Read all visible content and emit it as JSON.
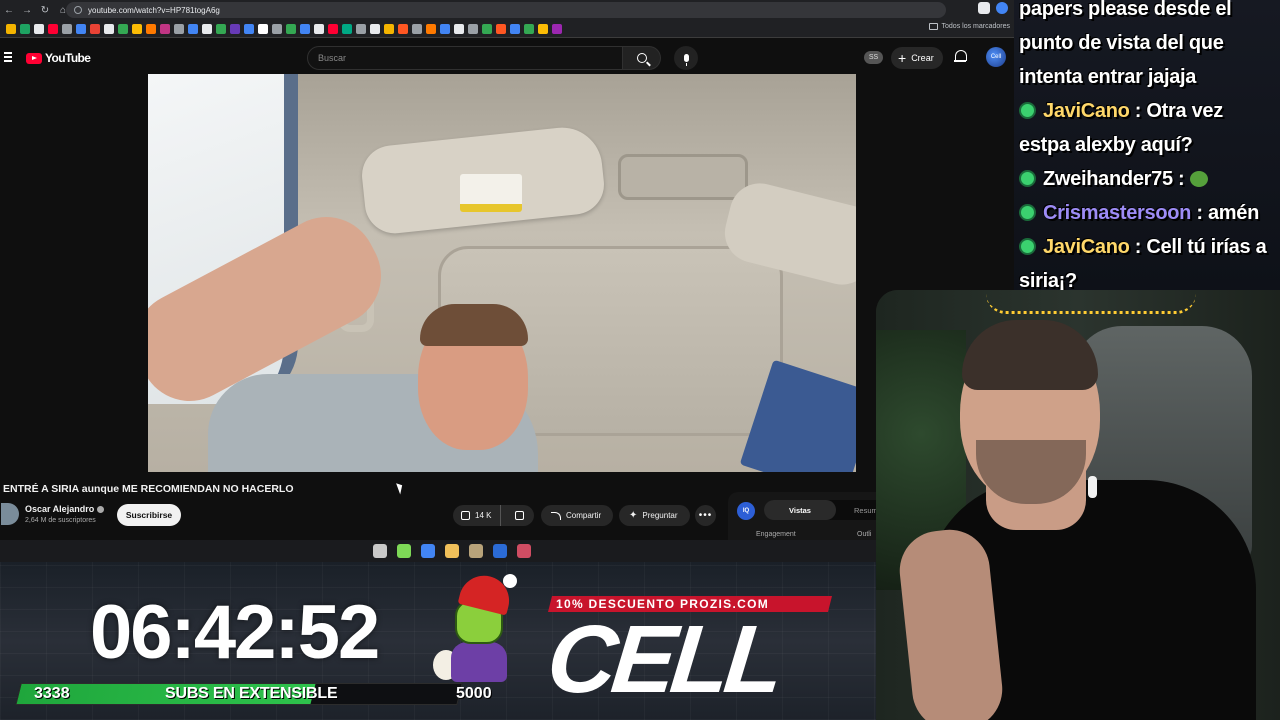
{
  "browser": {
    "url": "youtube.com/watch?v=HP781togA6g",
    "bookmarks_all_label": "Todos los marcadores",
    "bookmark_colors": [
      "#f4b400",
      "#1ea362",
      "#e8eaed",
      "#ff0033",
      "#9aa0a6",
      "#4285f4",
      "#ea4335",
      "#e8eaed",
      "#34a853",
      "#fbbc05",
      "#ff7a00",
      "#c13584",
      "#9aa0a6",
      "#4285f4",
      "#e8eaed",
      "#34a853",
      "#673ab7",
      "#4285f4",
      "#ffffff",
      "#9aa0a6",
      "#34a853",
      "#4285f4",
      "#e8eaed",
      "#ff0033",
      "#00a884",
      "#9aa0a6",
      "#e8eaed",
      "#f4b400",
      "#ff5722",
      "#9aa0a6",
      "#ff7a00",
      "#4285f4",
      "#e8eaed",
      "#9aa0a6",
      "#34a853",
      "#ff5722",
      "#4285f4",
      "#34a853",
      "#fbbc05",
      "#9c27b0"
    ]
  },
  "youtube": {
    "logo_text": "YouTube",
    "search_placeholder": "Buscar",
    "ss_badge": "SS",
    "create_label": "Crear",
    "avatar_text": "Cell"
  },
  "video": {
    "title": "ENTRÉ A SIRIA aunque ME RECOMIENDAN NO HACERLO",
    "channel_name": "Oscar Alejandro",
    "subscribers": "2,64 M de suscriptores",
    "subscribe_label": "Suscribirse",
    "likes": "14 K",
    "share_label": "Compartir",
    "ask_label": "Preguntar",
    "more_label": "•••"
  },
  "side_panel": {
    "icon_text": "IQ",
    "tab_active": "Vistas",
    "tab_other": "Resum",
    "engagement_label": "Engagement",
    "outlier_label": "Outli"
  },
  "taskbar": {
    "icon_colors": [
      "#c9c9c9",
      "#7ed957",
      "#4285f4",
      "#f0c05a",
      "#b8a37a",
      "#2b6bd6",
      "#d04d63"
    ],
    "icon_names": [
      "steam-icon",
      "xbox-icon",
      "chrome-icon",
      "file-explorer-icon",
      "app-icon",
      "photoshop-icon",
      "game-icon"
    ]
  },
  "chat": {
    "messages": [
      {
        "user": "",
        "text": "papers please desde el"
      },
      {
        "user": "",
        "text": "punto de vista del que"
      },
      {
        "user": "",
        "text": "intenta entrar jajaja"
      },
      {
        "user": "JaviCano",
        "text": " : Otra vez"
      },
      {
        "user": "",
        "text": "estpa alexby aquí?"
      },
      {
        "user": "Zweihander75",
        "text": " : "
      },
      {
        "user": "Crismastersoon",
        "text": " : amén"
      },
      {
        "user": "JaviCano",
        "text": " : Cell tú irías a"
      },
      {
        "user": "",
        "text": "siria¡?"
      }
    ]
  },
  "stream_overlay": {
    "timer": "06:42:52",
    "progress_start": "3338",
    "progress_label": "SUBS EN EXTENSIBLE",
    "progress_end": "5000",
    "progress_fraction": 0.6676,
    "promo_text": "10% DESCUENTO PROZIS.COM",
    "brand": "CELL"
  },
  "colors": {
    "yt_red": "#ff0033",
    "chat_user_yellow": "#ffd86a",
    "chat_user_purple": "#9d8cf6",
    "progress_green": "#2ec24c",
    "promo_red": "#c8142c"
  }
}
